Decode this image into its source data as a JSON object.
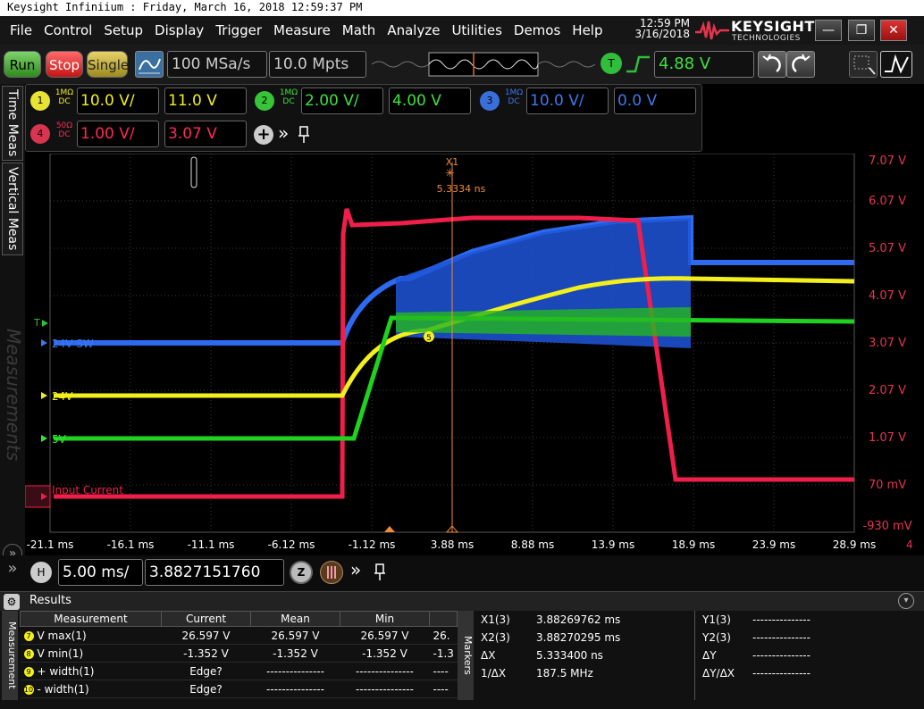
{
  "title_bar": "Keysight Infiniium : Friday, March 16, 2018 12:59:37 PM",
  "menu": [
    "File",
    "Control",
    "Setup",
    "Display",
    "Trigger",
    "Measure",
    "Math",
    "Analyze",
    "Utilities",
    "Demos",
    "Help"
  ],
  "clock": {
    "time": "12:59 PM",
    "date": "3/16/2018"
  },
  "brand": {
    "name": "KEYSIGHT",
    "sub": "TECHNOLOGIES"
  },
  "window_buttons": {
    "minimize": "—",
    "restore": "❐",
    "close": "✕"
  },
  "acq": {
    "run": "Run",
    "stop": "Stop",
    "single": "Single",
    "sample_rate": "100 MSa/s",
    "memory": "10.0 Mpts"
  },
  "trigger": {
    "badge": "T",
    "level": "4.88 V"
  },
  "channels": [
    {
      "num": "1",
      "coupling_top": "1MΩ",
      "coupling_bot": "DC",
      "scale": "10.0 V/",
      "offset": "11.0 V",
      "color": "#f2ef1c",
      "bg": "#e8e233",
      "text": "#f2ef1c"
    },
    {
      "num": "2",
      "coupling_top": "1MΩ",
      "coupling_bot": "DC",
      "scale": "2.00 V/",
      "offset": "4.00 V",
      "color": "#1fd21f",
      "bg": "#38c438",
      "text": "#3de23d"
    },
    {
      "num": "3",
      "coupling_top": "1MΩ",
      "coupling_bot": "DC",
      "scale": "10.0 V/",
      "offset": "0.0 V",
      "color": "#2d6af0",
      "bg": "#3a6ed8",
      "text": "#3d79ee"
    },
    {
      "num": "4",
      "coupling_top": "50Ω",
      "coupling_bot": "DC",
      "scale": "1.00 V/",
      "offset": "3.07 V",
      "color": "#ef1e4a",
      "bg": "#d93550",
      "text": "#ff2a56"
    }
  ],
  "side_tabs": [
    "Time Meas",
    "Vertical Meas",
    "Measurements"
  ],
  "graticule": {
    "right_axis": [
      "7.07 V",
      "6.07 V",
      "5.07 V",
      "4.07 V",
      "3.07 V",
      "2.07 V",
      "1.07 V",
      "70 mV",
      "-930 mV"
    ],
    "x_axis": [
      "-21.1 ms",
      "-16.1 ms",
      "-11.1 ms",
      "-6.12 ms",
      "-1.12 ms",
      "3.88 ms",
      "8.88 ms",
      "13.9 ms",
      "18.9 ms",
      "23.9 ms",
      "28.9 ms"
    ],
    "x_extra": "4",
    "cursor": {
      "name": "X1",
      "value": "5.3334 ns"
    },
    "trace_labels": {
      "sw24": "24V SW",
      "v24": "24V",
      "v5": "5V",
      "current": "Input Current"
    },
    "trigger_marker": "T",
    "marker5": "5"
  },
  "horizontal": {
    "badge": "H",
    "scale": "5.00 ms/",
    "position": "3.8827151760 ms",
    "zoom": "Z"
  },
  "results": {
    "title": "Results",
    "side_label": "Measurement",
    "markers_label": "Markers",
    "columns": [
      "Measurement",
      "Current",
      "Mean",
      "Min",
      ""
    ],
    "rows": [
      {
        "n": "7",
        "c": "#f2ef1c",
        "name": "V max(1)",
        "current": "26.597 V",
        "mean": "26.597 V",
        "min": "26.597 V",
        "max": "26."
      },
      {
        "n": "8",
        "c": "#f2ef1c",
        "name": "V min(1)",
        "current": "-1.352 V",
        "mean": "-1.352 V",
        "min": "-1.352 V",
        "max": "-1.3"
      },
      {
        "n": "9",
        "c": "#f2ef1c",
        "name": "+ width(1)",
        "current": "Edge?",
        "mean": "---------------",
        "min": "---------------",
        "max": "----"
      },
      {
        "n": "10",
        "c": "#f2ef1c",
        "name": "- width(1)",
        "current": "Edge?",
        "mean": "---------------",
        "min": "---------------",
        "max": "----"
      }
    ],
    "markers_x": [
      {
        "label": "X1(3)",
        "value": "3.88269762 ms"
      },
      {
        "label": "X2(3)",
        "value": "3.88270295 ms"
      },
      {
        "label": "ΔX",
        "value": "5.333400 ns"
      },
      {
        "label": "1/ΔX",
        "value": "187.5 MHz"
      }
    ],
    "markers_y": [
      {
        "label": "Y1(3)",
        "value": "---------------"
      },
      {
        "label": "Y2(3)",
        "value": "---------------"
      },
      {
        "label": "ΔY",
        "value": "---------------"
      },
      {
        "label": "ΔY/ΔX",
        "value": "---------------"
      }
    ]
  }
}
